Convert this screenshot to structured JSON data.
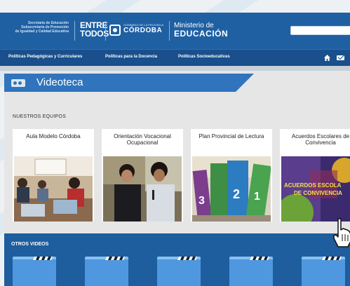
{
  "header": {
    "secretaria_lines": [
      "Secretaría de Educación",
      "Subsecretaría de Promoción",
      "de Igualdad y Calidad Educativa"
    ],
    "logo_entre": "ENTRE",
    "logo_todos": "TODOS",
    "logo_cordoba_sub": "GOBIERNO DE LA PROVINCIA",
    "logo_cordoba": "CÓRDOBA",
    "ministerio_line1": "Ministerio de",
    "ministerio_line2": "EDUCACIÓN",
    "search_placeholder": ""
  },
  "nav": {
    "items": [
      "Políticas Pedagógicas y Curriculares",
      "Políticas para la Docencia",
      "Políticas Socioeducativas"
    ],
    "icons": [
      "home-icon",
      "mail-icon"
    ]
  },
  "main": {
    "title": "Videoteca",
    "section_equipos": "NUESTROS EQUIPOS",
    "cards": [
      {
        "title": "Aula Modelo Córdoba"
      },
      {
        "title": "Orientación Vocacional Ocupacional"
      },
      {
        "title": "Plan Provincial de Lectura"
      },
      {
        "title": "Acuerdos Escolares de Convivencia"
      }
    ],
    "banner_text_1": "ACUERDOS ESCOLA",
    "banner_text_2": "DE CONVIVENCIA",
    "book_numbers": [
      "3",
      "2",
      "1"
    ],
    "section_otros": "OTROS VIDEOS"
  },
  "colors": {
    "header_blue": "#1f60a3",
    "nav_blue": "#184f8c",
    "title_blue": "#2f74bd",
    "otros_blue": "#1e5d9e"
  }
}
